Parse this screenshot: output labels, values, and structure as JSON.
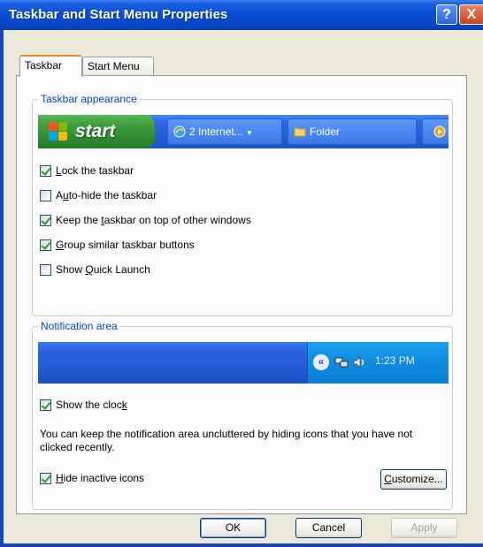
{
  "window": {
    "title": "Taskbar and Start Menu Properties",
    "help_label": "?",
    "close_label": "X"
  },
  "tabs": [
    {
      "label": "Taskbar",
      "active": true
    },
    {
      "label": "Start Menu",
      "active": false
    }
  ],
  "taskbar_appearance": {
    "group_label": "Taskbar appearance",
    "start_label": "start",
    "task_buttons": [
      {
        "label": "2 Internet...",
        "icon": "internet-explorer-icon"
      },
      {
        "label": "Folder",
        "icon": "folder-icon"
      }
    ],
    "options": [
      {
        "key": "L",
        "rest": "ock the taskbar",
        "checked": true
      },
      {
        "pre": "A",
        "key": "u",
        "rest": "to-hide the taskbar",
        "checked": false
      },
      {
        "pre": "Keep the ",
        "key": "t",
        "rest": "askbar on top of other windows",
        "checked": true
      },
      {
        "key": "G",
        "rest": "roup similar taskbar buttons",
        "checked": true
      },
      {
        "pre": "Show ",
        "key": "Q",
        "rest": "uick Launch",
        "checked": false
      }
    ]
  },
  "notification_area": {
    "group_label": "Notification area",
    "clock_text": "1:23 PM",
    "show_clock": {
      "pre": "Show the cloc",
      "key": "k",
      "checked": true
    },
    "info_text": "You can keep the notification area uncluttered by hiding icons that you have not clicked recently.",
    "hide_inactive": {
      "key": "H",
      "rest": "ide inactive icons",
      "checked": true
    },
    "customize": {
      "key": "C",
      "rest": "ustomize..."
    }
  },
  "footer": {
    "ok_label": "OK",
    "cancel_label": "Cancel",
    "apply_label": "Apply"
  },
  "colors": {
    "title_blue": "#0a4fd8",
    "start_green": "#3d9e3d",
    "tray_blue": "#0f8be0",
    "group_label": "#0046d5"
  }
}
